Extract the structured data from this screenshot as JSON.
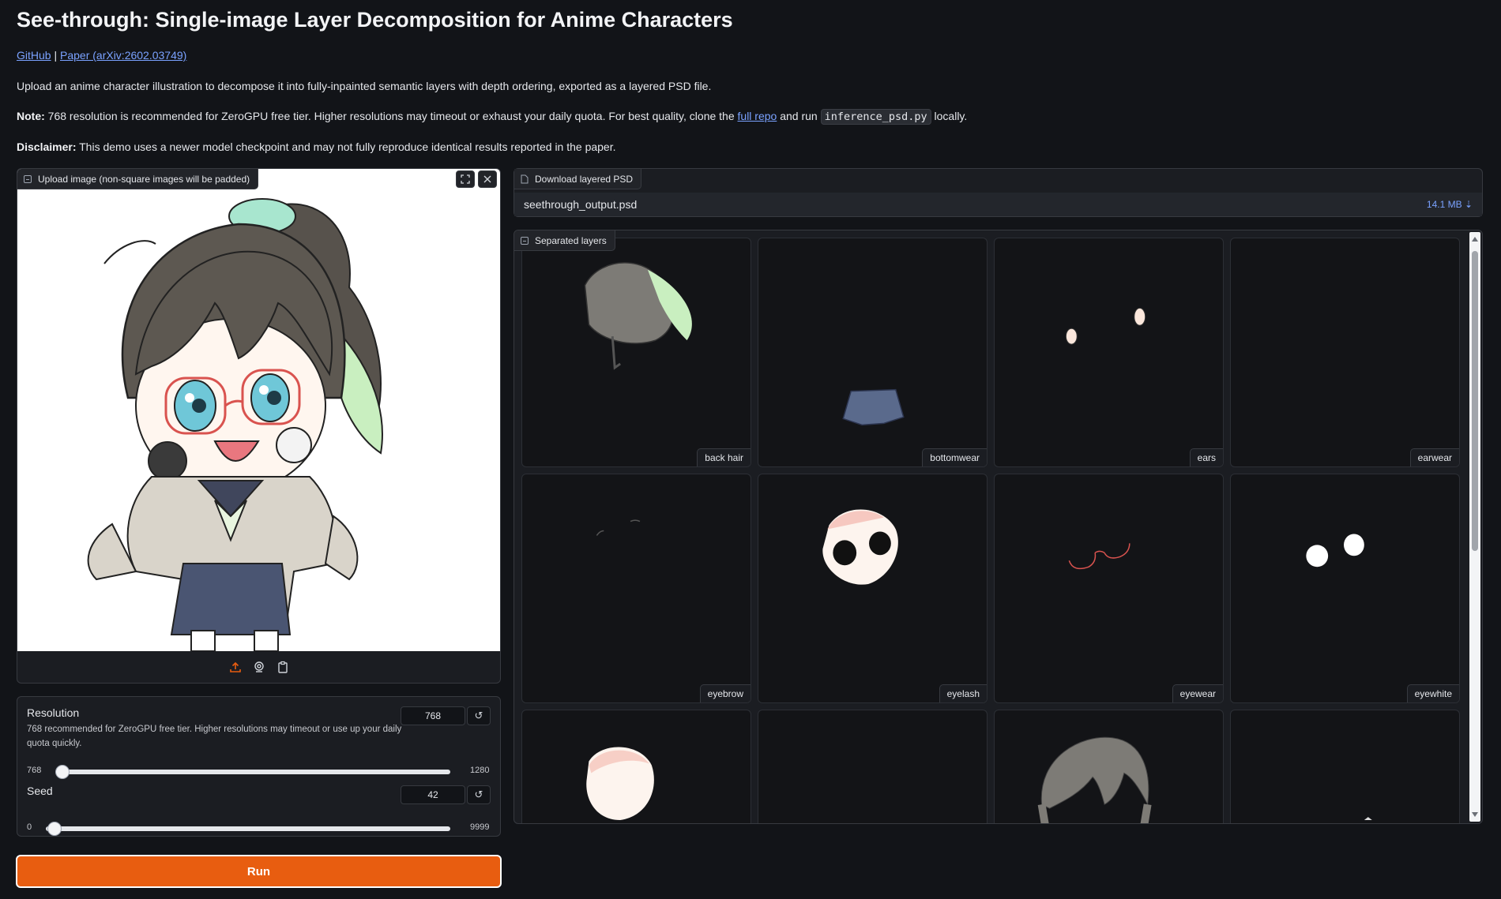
{
  "header": {
    "title": "See-through: Single-image Layer Decomposition for Anime Characters",
    "github_link": "GitHub",
    "separator": "|",
    "paper_link": "Paper (arXiv:2602.03749)",
    "description": "Upload an anime character illustration to decompose it into fully-inpainted semantic layers with depth ordering, exported as a layered PSD file.",
    "note_label": "Note:",
    "note_text_1": "768 resolution is recommended for ZeroGPU free tier. Higher resolutions may timeout or exhaust your daily quota. For best quality, clone the",
    "note_link": "full repo",
    "note_text_2": "and run",
    "note_code": "inference_psd.py",
    "note_text_3": "locally.",
    "disclaimer_label": "Disclaimer:",
    "disclaimer_text": "This demo uses a newer model checkpoint and may not fully reproduce identical results reported in the paper."
  },
  "upload": {
    "label": "Upload image (non-square images will be padded)",
    "icons": [
      "fullscreen-icon",
      "close-icon",
      "upload-icon",
      "webcam-icon",
      "clipboard-icon"
    ]
  },
  "settings": {
    "resolution": {
      "label": "Resolution",
      "description": "768 recommended for ZeroGPU free tier. Higher resolutions may timeout or use up your daily quota quickly.",
      "value": "768",
      "min": "768",
      "max": "1280",
      "fraction": 0.0
    },
    "seed": {
      "label": "Seed",
      "value": "42",
      "min": "0",
      "max": "9999",
      "fraction": 0.0042
    }
  },
  "run_label": "Run",
  "download": {
    "label": "Download layered PSD",
    "file_name": "seethrough_output.psd",
    "file_size": "14.1 MB"
  },
  "gallery": {
    "label": "Separated layers",
    "items": [
      {
        "caption": "back hair"
      },
      {
        "caption": "bottomwear"
      },
      {
        "caption": "ears"
      },
      {
        "caption": "earwear"
      },
      {
        "caption": "eyebrow"
      },
      {
        "caption": "eyelash"
      },
      {
        "caption": "eyewear"
      },
      {
        "caption": "eyewhite"
      },
      {
        "caption": ""
      },
      {
        "caption": ""
      },
      {
        "caption": ""
      },
      {
        "caption": ""
      }
    ]
  },
  "colors": {
    "background": "#121418",
    "accent_orange": "#e85d10",
    "link_blue": "#7aa2ff"
  }
}
